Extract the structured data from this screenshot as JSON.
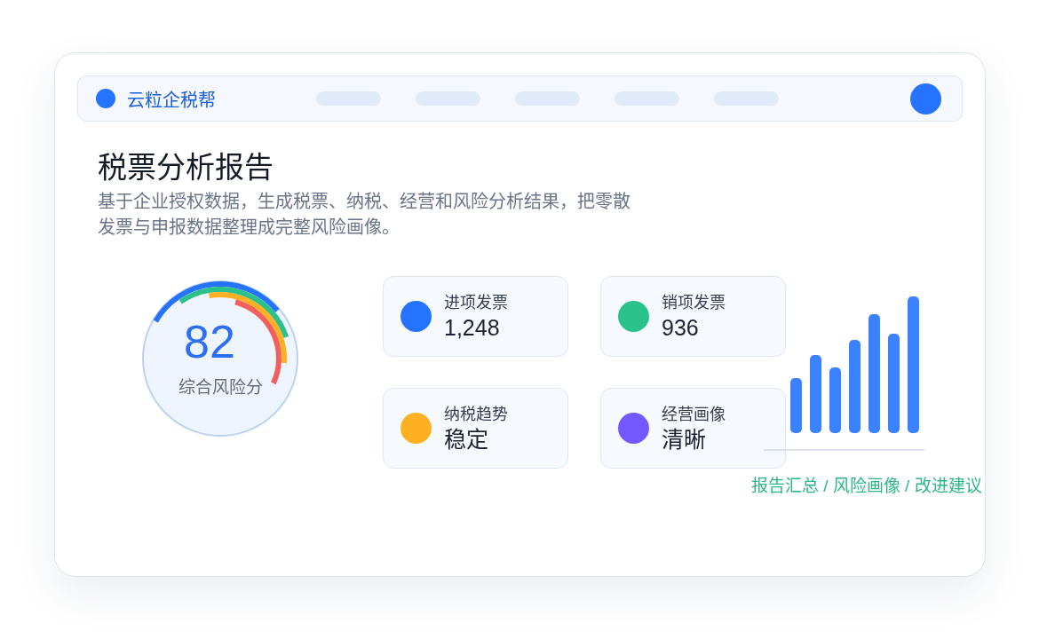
{
  "header": {
    "brand": "云粒企税帮"
  },
  "report": {
    "title": "税票分析报告",
    "description": "基于企业授权数据，生成税票、纳税、经营和风险分析结果，把零散发票与申报数据整理成完整风险画像。"
  },
  "score": {
    "value": "82",
    "label": "综合风险分"
  },
  "metrics": [
    {
      "label": "进项发票",
      "value": "1,248",
      "color": "#2673ff"
    },
    {
      "label": "销项发票",
      "value": "936",
      "color": "#2bc18b"
    },
    {
      "label": "纳税趋势",
      "value": "稳定",
      "color": "#fdb022"
    },
    {
      "label": "经营画像",
      "value": "清晰",
      "color": "#7357ff"
    }
  ],
  "chart_caption": "报告汇总 / 风险画像 / 改进建议"
}
